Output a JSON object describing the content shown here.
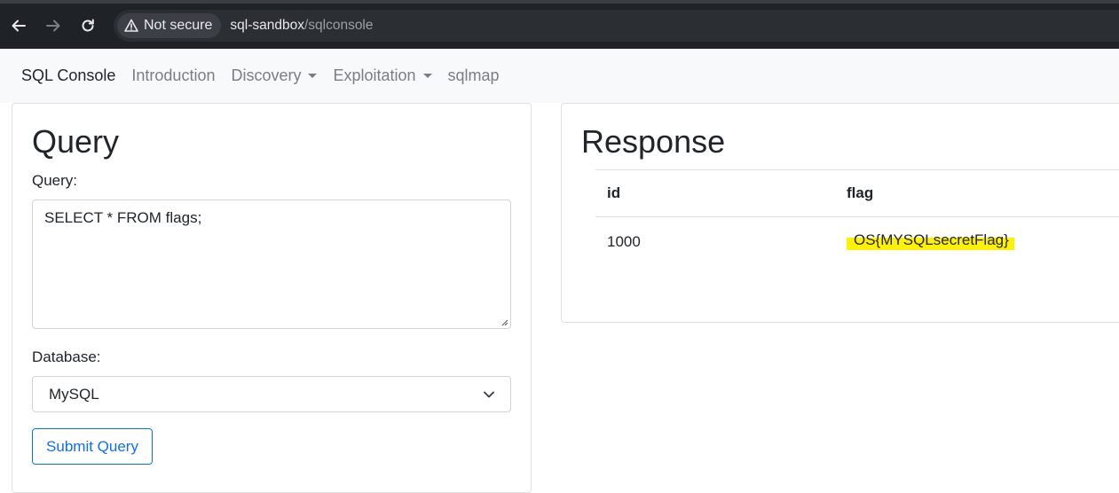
{
  "browser": {
    "security_label": "Not secure",
    "url_host": "sql-sandbox",
    "url_path": "/sqlconsole"
  },
  "navbar": {
    "brand": "SQL Console",
    "links": [
      {
        "label": "Introduction",
        "dropdown": false
      },
      {
        "label": "Discovery",
        "dropdown": true
      },
      {
        "label": "Exploitation",
        "dropdown": true
      },
      {
        "label": "sqlmap",
        "dropdown": false
      }
    ]
  },
  "query_panel": {
    "title": "Query",
    "query_label": "Query:",
    "query_value": "SELECT * FROM flags;",
    "database_label": "Database:",
    "database_selected": "MySQL",
    "submit_label": "Submit Query"
  },
  "response_panel": {
    "title": "Response",
    "columns": [
      "id",
      "flag"
    ],
    "rows": [
      [
        "1000",
        "OS{MYSQLsecretFlag}"
      ]
    ]
  },
  "colors": {
    "primary": "#0d6efd",
    "highlight": "#fff200",
    "browser_chrome": "#1f2227"
  }
}
